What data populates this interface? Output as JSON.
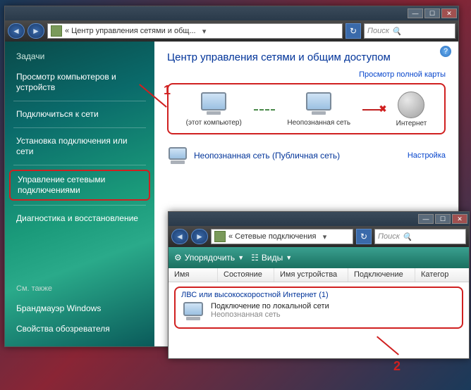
{
  "win1": {
    "address": "« Центр управления сетями и общ...",
    "search_placeholder": "Поиск",
    "title": "Центр управления сетями и общим доступом",
    "maplink": "Просмотр полной карты",
    "node_this": "(этот компьютер)",
    "node_unk": "Неопознанная сеть",
    "node_net": "Интернет",
    "nwrow_label": "Неопознанная сеть (Публичная сеть)",
    "nwrow_link": "Настройка"
  },
  "sidebar": {
    "head": "Задачи",
    "items": [
      "Просмотр компьютеров и устройств",
      "Подключиться к сети",
      "Установка подключения или сети",
      "Управление сетевыми подключениями",
      "Диагностика и восстановление"
    ],
    "foot_head": "См. также",
    "foot_items": [
      "Брандмауэр Windows",
      "Свойства обозревателя"
    ]
  },
  "win2": {
    "address": "« Сетевые подключения",
    "search_placeholder": "Поиск",
    "tb_org": "Упорядочить",
    "tb_views": "Виды",
    "cols": [
      "Имя",
      "Состояние",
      "Имя устройства",
      "Подключение",
      "Категор"
    ],
    "group": "ЛВС или высокоскоростной Интернет (1)",
    "conn_name": "Подключение по локальной сети",
    "conn_status": "Неопознанная сеть"
  },
  "callouts": {
    "one": "1",
    "two": "2"
  }
}
